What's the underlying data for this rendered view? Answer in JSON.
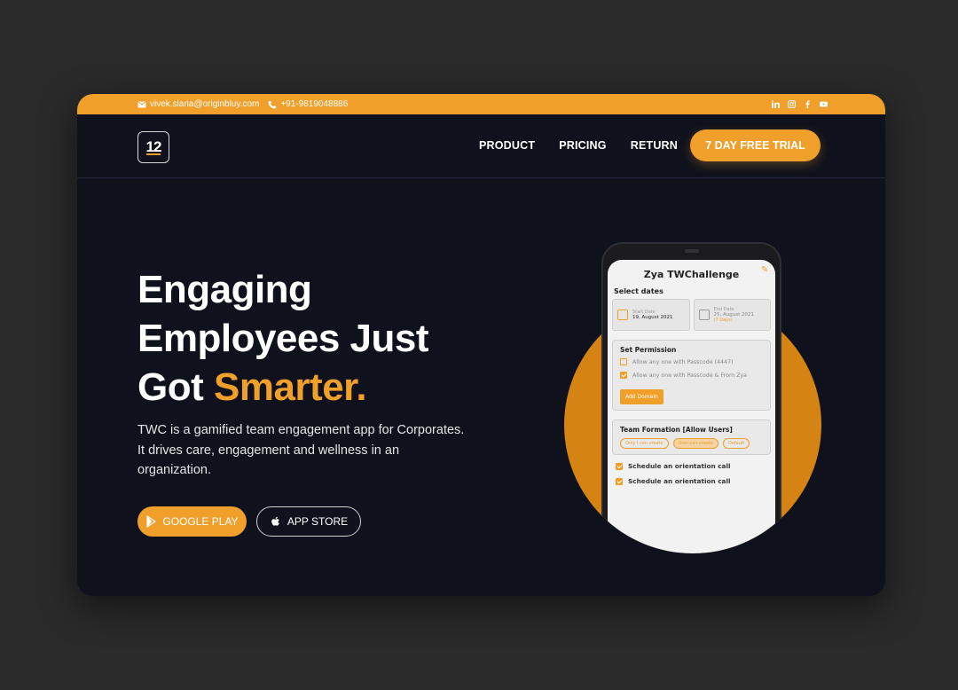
{
  "topbar": {
    "email": "vivek.slaria@originbluy.com",
    "phone": "+91-9819048886",
    "socials": [
      "linkedin-icon",
      "instagram-icon",
      "facebook-icon",
      "youtube-icon"
    ]
  },
  "logo": {
    "text": "12"
  },
  "nav": {
    "links": [
      "PRODUCT",
      "PRICING",
      "RETURN"
    ],
    "cta": "7 DAY FREE TRIAL"
  },
  "hero": {
    "line1": "Engaging",
    "line2": "Employees Just",
    "line3a": "Got ",
    "line3b": "Smarter.",
    "description": "TWC is a gamified team engagement app for Corporates. It drives care, engagement and wellness in an organization.",
    "google_play": "GOOGLE PLAY",
    "app_store": "APP STORE"
  },
  "phone_screen": {
    "title": "Zya TWChallenge",
    "select_dates": "Select dates",
    "start_label": "Start Date",
    "start_value": "19, August 2021",
    "end_label": "End Date",
    "end_value": "25, August 2021",
    "end_note": "(7 Days)",
    "permission_title": "Set Permission",
    "perm1": "Allow any one with Passcode (4447)",
    "perm2": "Allow any one with Passcode & From Zya",
    "add_domain": "Add Domain",
    "team_title": "Team Formation [Allow Users]",
    "pill1": "Only I can create",
    "pill2": "User can create",
    "pill3": "Default",
    "sched1": "Schedule an orientation call",
    "sched2": "Schedule an orientation call"
  },
  "colors": {
    "accent": "#f09f2a",
    "background": "#0f111c",
    "outer": "#2a2a2a"
  }
}
